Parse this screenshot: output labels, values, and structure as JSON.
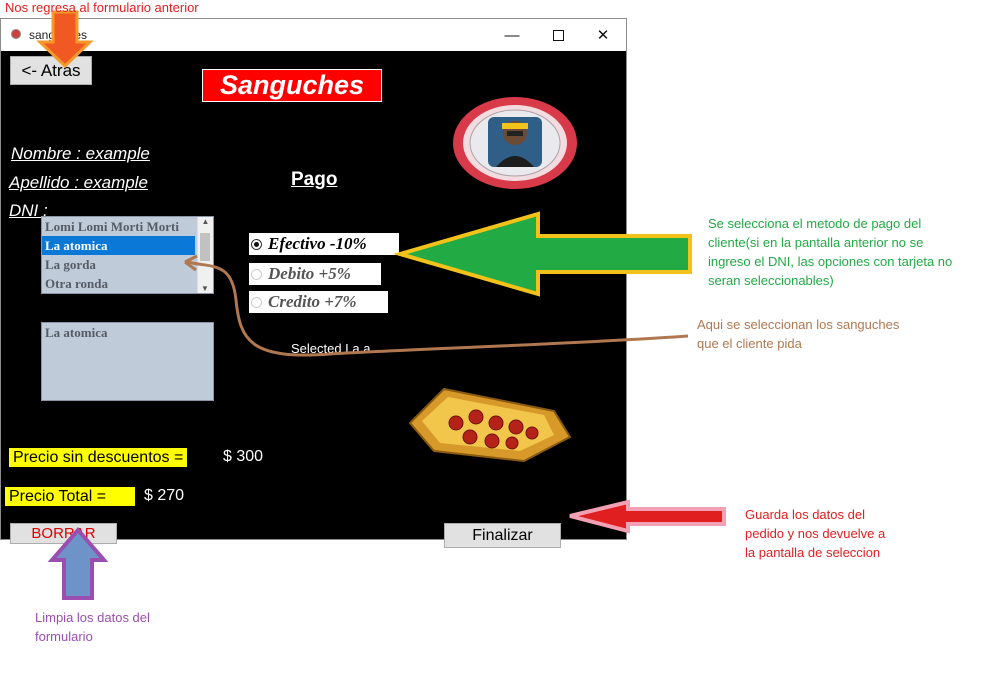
{
  "window": {
    "title": "sanguches",
    "minimize_icon": "minimize-icon",
    "maximize_icon": "maximize-icon",
    "close_icon": "close-icon"
  },
  "header": {
    "back_label": "<- Atras",
    "app_title": "Sanguches",
    "title_bg": "#ff0000"
  },
  "customer": {
    "nombre": "Nombre : example",
    "apellido": "Apellido : example",
    "dni": "DNI :"
  },
  "payment": {
    "heading": "Pago",
    "options": [
      {
        "label": "Efectivo -10%",
        "selected": true
      },
      {
        "label": "Debito +5%",
        "selected": false
      },
      {
        "label": "Credito +7%",
        "selected": false
      }
    ]
  },
  "menu_list": {
    "items": [
      "Lomi Lomi Morti Morti",
      "La atomica",
      "La gorda",
      "Otra ronda"
    ],
    "selected_index": 1
  },
  "order_list": {
    "items": [
      "La atomica"
    ]
  },
  "selected_text": "Selected La a",
  "prices": {
    "sin_descuentos_label": "Precio sin descuentos =",
    "sin_descuentos_value": "$ 300",
    "total_label": "Precio Total =",
    "total_value": "$ 270"
  },
  "actions": {
    "borrar_label": "BORRAR",
    "finalizar_label": "Finalizar"
  },
  "annotations": {
    "atras": "Nos regresa al formulario anterior",
    "pago": "Se selecciona el metodo de pago del cliente(si en la pantalla anterior no se ingreso el DNI, las opciones con tarjeta no seran seleccionables)",
    "sanguches": "Aqui se seleccionan los sanguches que el cliente pida",
    "finalizar": "Guarda los datos del pedido y nos devuelve a la pantalla de seleccion",
    "borrar": "Limpia los datos del formulario"
  },
  "colors": {
    "annotation_red": "#e02020",
    "annotation_green": "#22aa44",
    "annotation_brown": "#b07850",
    "annotation_purple": "#9a4fb0",
    "highlight_yellow": "#ffff00"
  }
}
